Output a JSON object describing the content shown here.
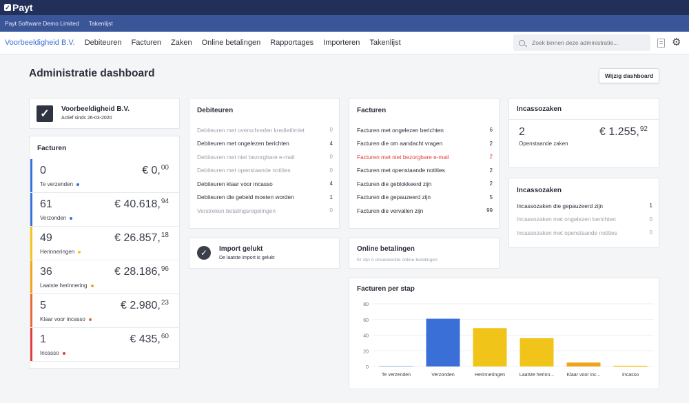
{
  "app": {
    "logo_text": "Payt",
    "logo_icon": "check-square-icon"
  },
  "subbar": {
    "org": "Payt Software Demo Limited",
    "tasks": "Takenlijst"
  },
  "nav": {
    "items": [
      "Voorbeeldigheid B.V.",
      "Debiteuren",
      "Facturen",
      "Zaken",
      "Online betalingen",
      "Rapportages",
      "Importeren",
      "Takenlijst"
    ],
    "search_placeholder": "Zoek binnen deze administratie..."
  },
  "page": {
    "title": "Administratie dashboard",
    "edit_button": "Wijzig dashboard"
  },
  "company": {
    "name": "Voorbeeldigheid B.V.",
    "since": "Actief sinds 26-03-2020"
  },
  "facturen_summary": {
    "title": "Facturen",
    "rows": [
      {
        "count": "0",
        "label": "Te verzenden",
        "amount": "€ 0,",
        "cents": "00",
        "color": "#3b6fd8"
      },
      {
        "count": "61",
        "label": "Verzonden",
        "amount": "€ 40.618,",
        "cents": "94",
        "color": "#3b6fd8"
      },
      {
        "count": "49",
        "label": "Herinneringen",
        "amount": "€ 26.857,",
        "cents": "18",
        "color": "#f0c419"
      },
      {
        "count": "36",
        "label": "Laatste herinnering",
        "amount": "€ 28.186,",
        "cents": "96",
        "color": "#f0a419"
      },
      {
        "count": "5",
        "label": "Klaar voor incasso",
        "amount": "€ 2.980,",
        "cents": "23",
        "color": "#e8663a"
      },
      {
        "count": "1",
        "label": "Incasso",
        "amount": "€ 435,",
        "cents": "60",
        "color": "#e03a3a"
      }
    ]
  },
  "debiteuren": {
    "title": "Debiteuren",
    "rows": [
      {
        "label": "Debiteuren met overschreden kredietlimiet",
        "count": "0",
        "state": "muted"
      },
      {
        "label": "Debiteuren met ongelezen berichten",
        "count": "4",
        "state": "normal"
      },
      {
        "label": "Debiteuren met niet bezorgbare e-mail",
        "count": "0",
        "state": "muted"
      },
      {
        "label": "Debiteuren met openstaande notities",
        "count": "0",
        "state": "muted"
      },
      {
        "label": "Debiteuren klaar voor incasso",
        "count": "4",
        "state": "normal"
      },
      {
        "label": "Debiteuren die gebeld moeten worden",
        "count": "1",
        "state": "normal"
      },
      {
        "label": "Verstreken betalingsregelingen",
        "count": "0",
        "state": "muted"
      }
    ]
  },
  "facturen_list": {
    "title": "Facturen",
    "rows": [
      {
        "label": "Facturen met ongelezen berichten",
        "count": "6",
        "state": "normal"
      },
      {
        "label": "Facturen die om aandacht vragen",
        "count": "2",
        "state": "normal"
      },
      {
        "label": "Facturen met niet bezorgbare e-mail",
        "count": "2",
        "state": "red"
      },
      {
        "label": "Facturen met openstaande notities",
        "count": "2",
        "state": "normal"
      },
      {
        "label": "Facturen die geblokkeerd zijn",
        "count": "2",
        "state": "normal"
      },
      {
        "label": "Facturen die gepauzeerd zijn",
        "count": "5",
        "state": "normal"
      },
      {
        "label": "Facturen die vervallen zijn",
        "count": "99",
        "state": "normal"
      }
    ]
  },
  "incasso_summary": {
    "title": "Incassozaken",
    "count": "2",
    "label": "Openstaande zaken",
    "amount": "€ 1.255,",
    "cents": "92"
  },
  "incasso_list": {
    "title": "Incassozaken",
    "rows": [
      {
        "label": "Incassozaken die gepauzeerd zijn",
        "count": "1",
        "state": "normal"
      },
      {
        "label": "Incassozaken met ongelezen berichten",
        "count": "0",
        "state": "muted"
      },
      {
        "label": "Incassozaken met openstaande notities",
        "count": "0",
        "state": "muted"
      }
    ]
  },
  "import": {
    "title": "Import gelukt",
    "subtitle": "De laatste import is gelukt"
  },
  "online": {
    "title": "Online betalingen",
    "subtitle": "Er zijn 0 onverwerkte online betalingen"
  },
  "chart_data": {
    "type": "bar",
    "title": "Facturen per stap",
    "categories": [
      "Te verzenden",
      "Verzonden",
      "Herinneringen",
      "Laatste herinn...",
      "Klaar voor inc...",
      "Incasso"
    ],
    "values": [
      0,
      61,
      49,
      36,
      5,
      1
    ],
    "colors": [
      "#3b6fd8",
      "#3b6fd8",
      "#f0c419",
      "#f0c419",
      "#f0a419",
      "#f0c419"
    ],
    "ylim": [
      0,
      80
    ],
    "yticks": [
      0,
      20,
      40,
      60,
      80
    ],
    "grid": true
  }
}
